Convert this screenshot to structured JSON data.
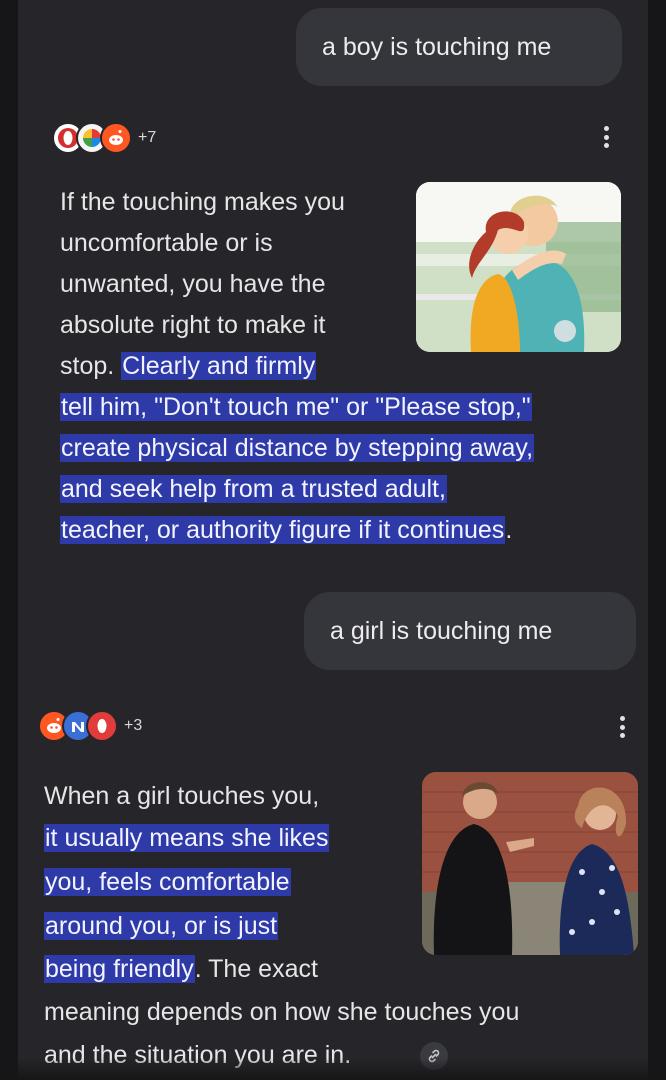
{
  "messages": {
    "user_query_1": "a boy is touching me",
    "user_query_2": "a girl is touching me"
  },
  "response_1": {
    "source_count": "+7",
    "lines": [
      "If the touching makes you",
      "uncomfortable or is",
      "unwanted, you have the",
      "absolute right to make it",
      "stop.",
      "Clearly and firmly",
      "tell him, \"Don't touch me\" or \"Please stop,\"",
      "create physical distance by stepping away,",
      "and seek help from a trusted adult,",
      "teacher, or authority figure if it continues",
      "."
    ]
  },
  "response_2": {
    "source_count": "+3",
    "lines": [
      "When a girl touches you,",
      "it usually means she likes",
      "you, feels comfortable",
      "around you, or is just",
      "being friendly",
      ". The exact",
      "meaning depends on how she touches you",
      "and the situation you are in."
    ]
  },
  "colors": {
    "background": "#26262a",
    "user_bubble": "#35363b",
    "highlight": "#2d3aa8",
    "text": "#e6e6e8"
  },
  "icons": {
    "more_options": "kebab-vertical-icon",
    "link": "link-icon",
    "sources": "source-favicons"
  }
}
